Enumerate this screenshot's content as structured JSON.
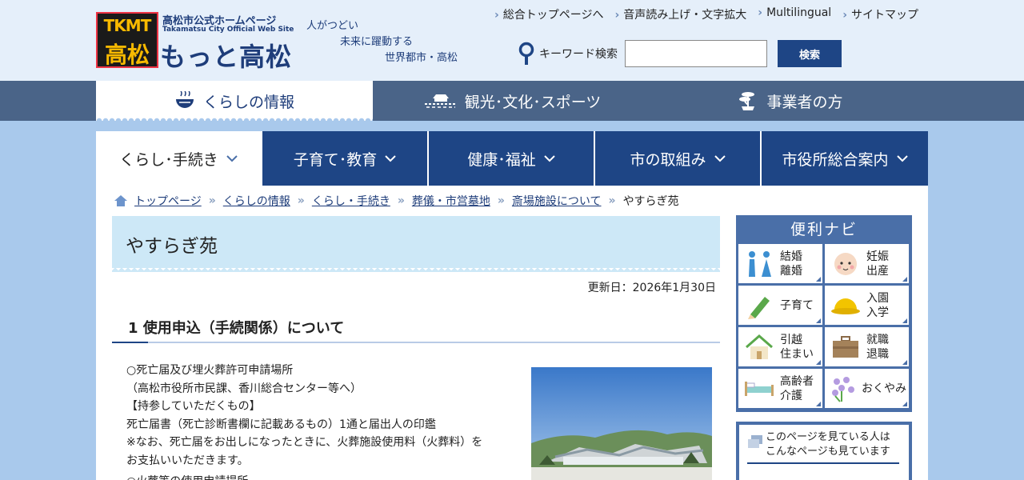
{
  "header": {
    "logo_line1": "TKMT",
    "logo_line2": "高松",
    "site_title": "高松市公式ホームページ",
    "site_subtitle": "Takamatsu City Official Web Site",
    "site_name": "もっと高松",
    "slogan": [
      "人がつどい",
      "未来に躍動する",
      "世界都市・高松"
    ],
    "util_links": [
      "総合トップページへ",
      "音声読み上げ・文字拡大",
      "Multilingual",
      "サイトマップ"
    ],
    "search": {
      "label": "キーワード検索",
      "value": "",
      "button": "検索"
    }
  },
  "categories": [
    {
      "label": "くらしの情報",
      "icon": "bowl-icon",
      "active": true
    },
    {
      "label": "観光･文化･スポーツ",
      "icon": "castle-icon",
      "active": false
    },
    {
      "label": "事業者の方",
      "icon": "bonsai-icon",
      "active": false
    }
  ],
  "nav_tabs": [
    {
      "label": "くらし･手続き",
      "active": true
    },
    {
      "label": "子育て･教育",
      "active": false
    },
    {
      "label": "健康･福祉",
      "active": false
    },
    {
      "label": "市の取組み",
      "active": false
    },
    {
      "label": "市役所総合案内",
      "active": false
    }
  ],
  "breadcrumb": [
    "トップページ",
    "くらしの情報",
    "くらし・手続き",
    "葬儀・市営墓地",
    "斎場施設について",
    "やすらぎ苑"
  ],
  "page": {
    "title": "やすらぎ苑",
    "updated": "更新日：2026年1月30日",
    "section_heading": "1 使用申込（手続関係）について",
    "body_lines": [
      "○死亡届及び埋火葬許可申請場所",
      "（高松市役所市民課、香川総合センター等へ）",
      "【持参していただくもの】",
      "死亡届書（死亡診断書欄に記載あるもの）1通と届出人の印鑑",
      "※なお、死亡届をお出しになったときに、火葬施設使用料（火葬料）を",
      "お支払いいただきます。",
      "○火葬等の使用申請場所"
    ]
  },
  "side_nav": {
    "title": "便利ナビ",
    "items": [
      {
        "label": "結婚\n離婚",
        "icon": "couple-icon"
      },
      {
        "label": "妊娠\n出産",
        "icon": "baby-icon"
      },
      {
        "label": "子育て",
        "icon": "pencil-icon"
      },
      {
        "label": "入園\n入学",
        "icon": "school-hat-icon"
      },
      {
        "label": "引越\n住まい",
        "icon": "house-icon"
      },
      {
        "label": "就職\n退職",
        "icon": "briefcase-icon"
      },
      {
        "label": "高齢者\n介護",
        "icon": "bed-icon"
      },
      {
        "label": "おくやみ",
        "icon": "flower-icon"
      }
    ]
  },
  "related": {
    "line1": "このページを見ている人は",
    "line2": "こんなページも見ています"
  },
  "colors": {
    "navy": "#1e4585",
    "header_bg": "#e5effa",
    "page_bg": "#a9c9ec",
    "title_bg": "#cde8f7"
  }
}
